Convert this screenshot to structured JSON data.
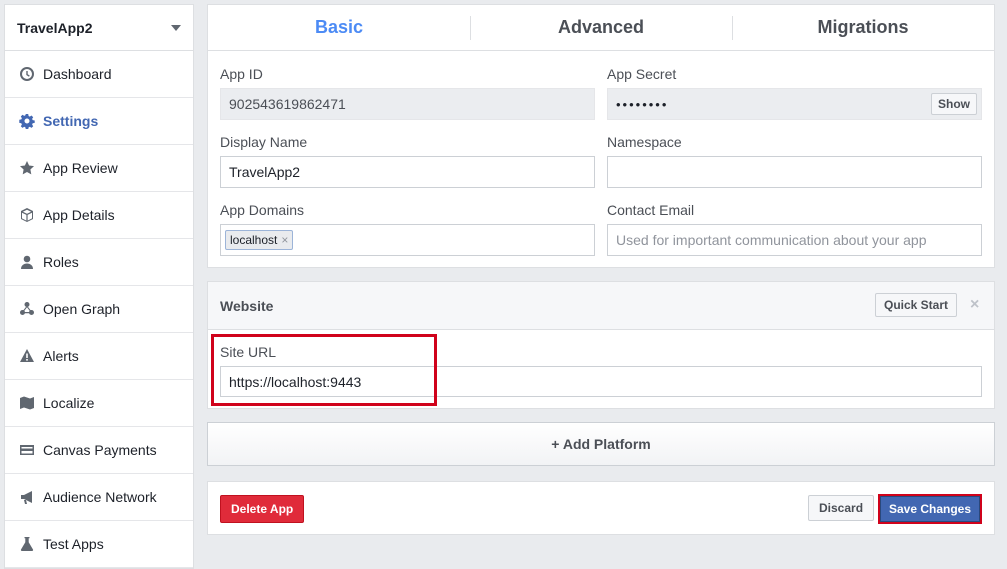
{
  "sidebar": {
    "app_name": "TravelApp2",
    "items": [
      {
        "label": "Dashboard",
        "icon": "dashboard-icon",
        "active": false
      },
      {
        "label": "Settings",
        "icon": "gear-icon",
        "active": true
      },
      {
        "label": "App Review",
        "icon": "star-icon",
        "active": false
      },
      {
        "label": "App Details",
        "icon": "cube-icon",
        "active": false
      },
      {
        "label": "Roles",
        "icon": "user-icon",
        "active": false
      },
      {
        "label": "Open Graph",
        "icon": "graph-icon",
        "active": false
      },
      {
        "label": "Alerts",
        "icon": "warning-icon",
        "active": false
      },
      {
        "label": "Localize",
        "icon": "map-icon",
        "active": false
      },
      {
        "label": "Canvas Payments",
        "icon": "card-icon",
        "active": false
      },
      {
        "label": "Audience Network",
        "icon": "megaphone-icon",
        "active": false
      },
      {
        "label": "Test Apps",
        "icon": "flask-icon",
        "active": false
      }
    ]
  },
  "tabs": [
    {
      "label": "Basic",
      "active": true
    },
    {
      "label": "Advanced",
      "active": false
    },
    {
      "label": "Migrations",
      "active": false
    }
  ],
  "basic": {
    "app_id_label": "App ID",
    "app_id_value": "902543619862471",
    "app_secret_label": "App Secret",
    "app_secret_value": "••••••••",
    "show_label": "Show",
    "display_name_label": "Display Name",
    "display_name_value": "TravelApp2",
    "namespace_label": "Namespace",
    "namespace_value": "",
    "app_domains_label": "App Domains",
    "app_domain_tag": "localhost",
    "contact_email_label": "Contact Email",
    "contact_email_placeholder": "Used for important communication about your app"
  },
  "website": {
    "title": "Website",
    "quick_start_label": "Quick Start",
    "close_glyph": "×",
    "site_url_label": "Site URL",
    "site_url_value": "https://localhost:9443"
  },
  "add_platform_label": "+ Add Platform",
  "footer": {
    "delete_label": "Delete App",
    "discard_label": "Discard",
    "save_label": "Save Changes"
  },
  "colors": {
    "accent": "#4267b2",
    "active_tab": "#4c8bf5",
    "danger": "#e02b3a",
    "highlight": "#d0021b"
  }
}
